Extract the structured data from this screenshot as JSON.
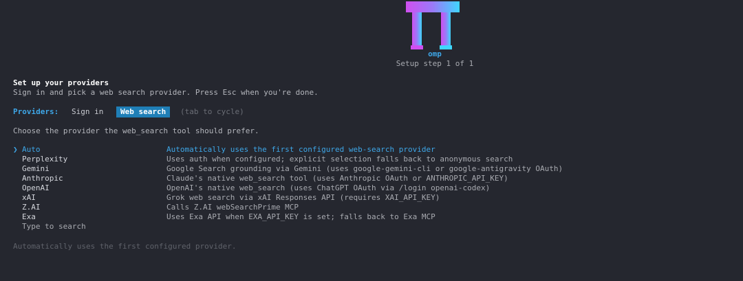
{
  "logo": {
    "label": "omp",
    "gradient_start": "#d04ff0",
    "gradient_end": "#3fd6ff"
  },
  "step_text": "Setup step 1 of 1",
  "title": "Set up your providers",
  "subtitle": "Sign in and pick a web search provider. Press Esc when you're done.",
  "tabs": {
    "label": "Providers:",
    "items": [
      {
        "label": "Sign in",
        "active": false
      },
      {
        "label": "Web search",
        "active": true
      }
    ],
    "hint": "(tab to cycle)"
  },
  "prompt": "Choose the provider the web_search tool should prefer.",
  "cursor_glyph": "❯",
  "providers": [
    {
      "name": "Auto",
      "description": "Automatically uses the first configured web-search provider",
      "selected": true
    },
    {
      "name": "Perplexity",
      "description": "Uses auth when configured; explicit selection falls back to anonymous search",
      "selected": false
    },
    {
      "name": "Gemini",
      "description": "Google Search grounding via Gemini (uses google-gemini-cli or google-antigravity OAuth)",
      "selected": false
    },
    {
      "name": "Anthropic",
      "description": "Claude's native web_search tool (uses Anthropic OAuth or ANTHROPIC_API_KEY)",
      "selected": false
    },
    {
      "name": "OpenAI",
      "description": "OpenAI's native web_search (uses ChatGPT OAuth via /login openai-codex)",
      "selected": false
    },
    {
      "name": "xAI",
      "description": "Grok web search via xAI Responses API (requires XAI_API_KEY)",
      "selected": false
    },
    {
      "name": "Z.AI",
      "description": "Calls Z.AI webSearchPrime MCP",
      "selected": false
    },
    {
      "name": "Exa",
      "description": "Uses Exa API when EXA_API_KEY is set; falls back to Exa MCP",
      "selected": false
    }
  ],
  "search_hint": "Type to search",
  "footer": "Automatically uses the first configured provider.",
  "colors": {
    "background": "#25272f",
    "accent": "#3ea7e8",
    "tab_active_bg": "#1f7fb7"
  }
}
